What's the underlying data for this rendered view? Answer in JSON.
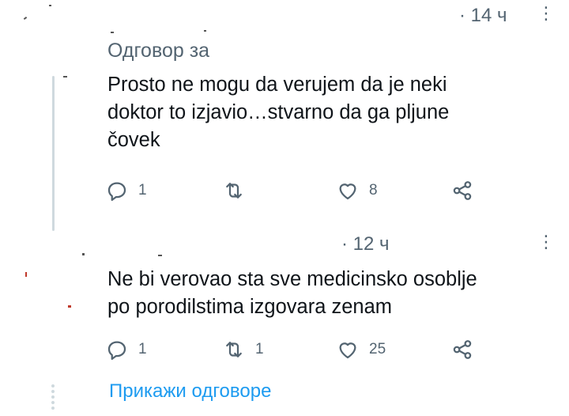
{
  "tweets": [
    {
      "time": "· 14 ч",
      "reply_to_label": "Одговор за",
      "text_lines": [
        "Prosto ne mogu da verujem da je neki",
        "doktor to izjavio…stvarno da ga pljune",
        "čovek"
      ],
      "actions": {
        "reply": "1",
        "retweet": "",
        "like": "8"
      }
    },
    {
      "time": "· 12 ч",
      "text_lines": [
        "Ne bi verovao sta sve medicinsko osoblje",
        "po porodilstima izgovara zenam"
      ],
      "actions": {
        "reply": "1",
        "retweet": "1",
        "like": "25"
      }
    }
  ],
  "show_replies": "Прикажи одговоре",
  "icons": [
    "reply-icon",
    "retweet-icon",
    "like-icon",
    "share-icon",
    "more-icon"
  ],
  "colors": {
    "link": "#1d9bf0",
    "muted": "#536471",
    "thread_line": "#cfd9de"
  }
}
